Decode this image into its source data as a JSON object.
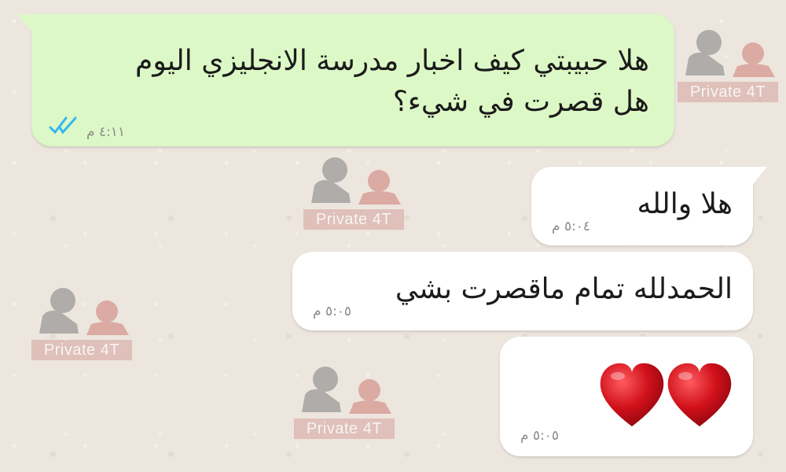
{
  "chat": {
    "messages": [
      {
        "direction": "outgoing",
        "lines": [
          "هلا حبيبتي كيف اخبار مدرسة الانجليزي اليوم",
          "هل قصرت في شيء؟"
        ],
        "time": "٤:١١ م",
        "status_icon": "double-check-icon",
        "status_color": "#34b7f1"
      },
      {
        "direction": "incoming",
        "text": "هلا والله",
        "time": "٥:٠٤ م"
      },
      {
        "direction": "incoming",
        "text": "الحمدلله  تمام ماقصرت بشي",
        "time": "٥:٠٥ م"
      },
      {
        "direction": "incoming",
        "emoji": [
          "red-heart-icon",
          "red-heart-icon"
        ],
        "time": "٥:٠٥ م"
      }
    ]
  },
  "colors": {
    "outgoing_bubble": "#dcf8c6",
    "incoming_bubble": "#ffffff",
    "background": "#ece6de",
    "heart": "#c8141c"
  },
  "watermark": {
    "text": "Private 4T",
    "icon": "teacher-student-icon"
  }
}
